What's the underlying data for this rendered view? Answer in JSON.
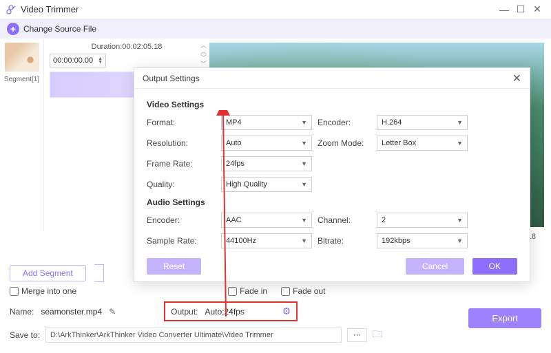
{
  "window": {
    "title": "Video Trimmer"
  },
  "toolbar": {
    "change_source": "Change Source File"
  },
  "segment": {
    "label": "Segment[1]"
  },
  "duration": {
    "label": "Duration:00:02:05.18",
    "start": "00:00:00.00",
    "end_display": ".18"
  },
  "modal": {
    "title": "Output Settings",
    "video_h": "Video Settings",
    "audio_h": "Audio Settings",
    "labels": {
      "format": "Format:",
      "encoder": "Encoder:",
      "resolution": "Resolution:",
      "zoom": "Zoom Mode:",
      "framerate": "Frame Rate:",
      "quality": "Quality:",
      "aencoder": "Encoder:",
      "channel": "Channel:",
      "sample": "Sample Rate:",
      "bitrate": "Bitrate:"
    },
    "values": {
      "format": "MP4",
      "encoder": "H.264",
      "resolution": "Auto",
      "zoom": "Letter Box",
      "framerate": "24fps",
      "quality": "High Quality",
      "aencoder": "AAC",
      "channel": "2",
      "sample": "44100Hz",
      "bitrate": "192kbps"
    },
    "buttons": {
      "reset": "Reset",
      "cancel": "Cancel",
      "ok": "OK"
    }
  },
  "bottom": {
    "add_segment": "Add Segment",
    "merge": "Merge into one",
    "fade_in": "Fade in",
    "fade_out": "Fade out",
    "name_label": "Name:",
    "filename": "seamonster.mp4",
    "output_label": "Output:",
    "output_value": "Auto;24fps",
    "export": "Export",
    "save_label": "Save to:",
    "save_path": "D:\\ArkThinker\\ArkThinker Video Converter Ultimate\\Video Trimmer",
    "ellipsis": "···"
  }
}
